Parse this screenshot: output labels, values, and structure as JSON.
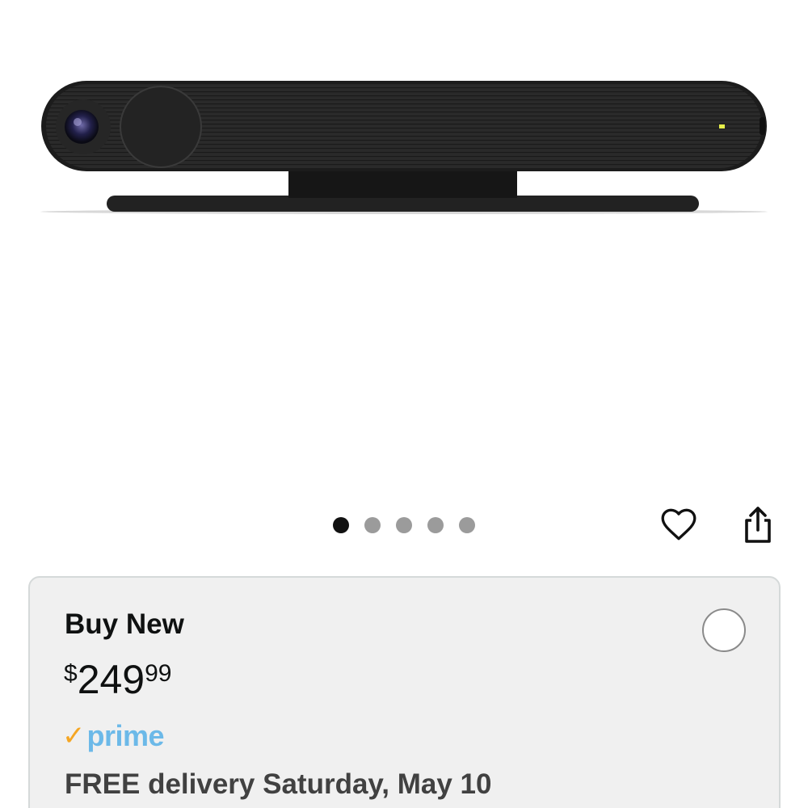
{
  "product": {
    "image_alt": "Black soundbar-style video conferencing camera on stand"
  },
  "carousel": {
    "dots": [
      "1",
      "2",
      "3",
      "4",
      "5"
    ],
    "active_index": 0
  },
  "actions": {
    "wishlist_icon": "heart-icon",
    "share_icon": "share-icon"
  },
  "buy_box": {
    "title": "Buy New",
    "price": {
      "currency": "$",
      "whole": "249",
      "fraction": "99"
    },
    "prime": {
      "check": "✓",
      "label": "prime"
    },
    "delivery": "FREE delivery Saturday, May 10",
    "colors": {
      "prime_check": "#f5a623",
      "prime_text": "#6cb9e8",
      "background": "#f0f0f0"
    }
  }
}
